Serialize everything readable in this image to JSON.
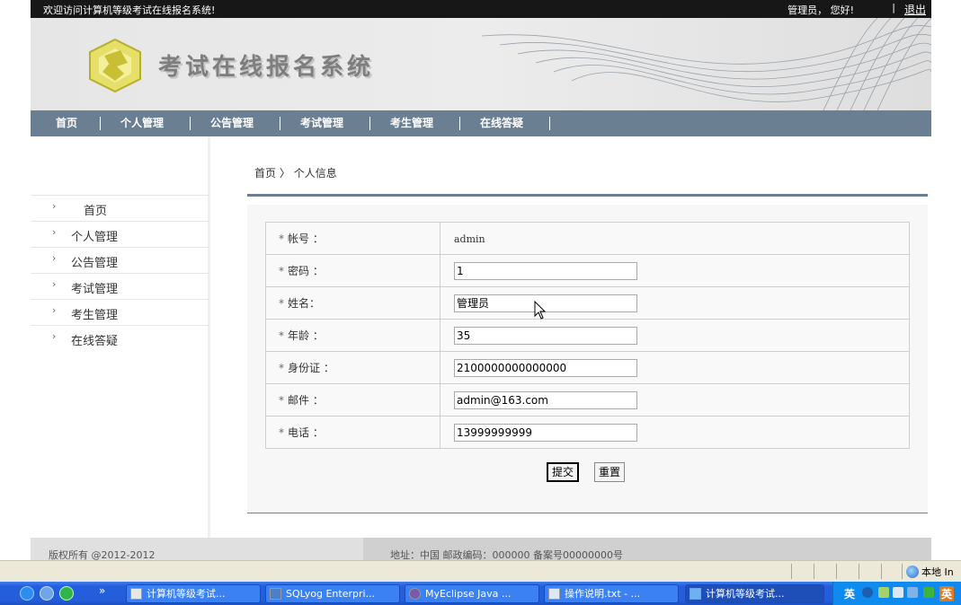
{
  "topbar": {
    "welcome": "欢迎访问计算机等级考试在线报名系统!",
    "user": "管理员，  您好!",
    "separator": "|",
    "logout": "退出"
  },
  "banner": {
    "title": "考试在线报名系统"
  },
  "nav": {
    "items": [
      "首页",
      "个人管理",
      "公告管理",
      "考试管理",
      "考生管理",
      "在线答疑"
    ],
    "separator": "|"
  },
  "sidebar": {
    "chevron": "›",
    "items": [
      "首页",
      "个人管理",
      "公告管理",
      "考试管理",
      "考生管理",
      "在线答疑"
    ]
  },
  "breadcrumb": {
    "home": "首页",
    "separator": "〉",
    "current": "个人信息"
  },
  "form": {
    "star": "*",
    "account_label": "帐号 ：",
    "account_value": "admin",
    "password_label": "密码 ：",
    "password_value": "1",
    "name_label": "姓名：",
    "name_value": "管理员",
    "age_label": "年龄 ：",
    "age_value": "35",
    "idcard_label": "身份证 ：",
    "idcard_value": "2100000000000000",
    "email_label": "邮件 ：",
    "email_value": "admin@163.com",
    "phone_label": "电话 ：",
    "phone_value": "13999999999",
    "submit": "提交",
    "reset": "重置"
  },
  "footer": {
    "copyright": "版权所有 @2012-2012",
    "address": "地址：中国 邮政编码：000000    备案号00000000号"
  },
  "statusbar": {
    "zone": "本地 In"
  },
  "taskbar": {
    "tasks": [
      "计算机等级考试...",
      "SQLyog Enterpri...",
      "MyEclipse Java ...",
      "操作说明.txt - ...",
      "计算机等级考试..."
    ],
    "tray_ime": "英",
    "tray_ime2": "英",
    "quicklaunch_more": "»"
  },
  "colors": {
    "nav_bg": "#6b7f93",
    "topbar_bg": "#171717",
    "taskbar": "#245edb",
    "tray": "#0f8bef"
  }
}
